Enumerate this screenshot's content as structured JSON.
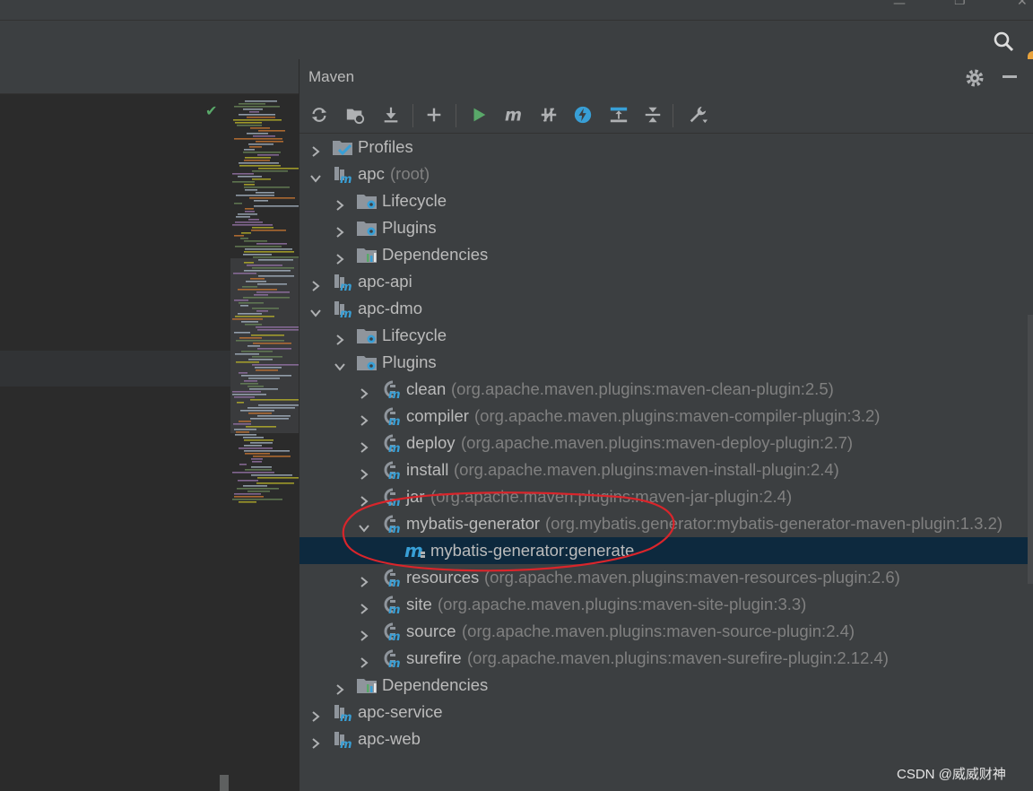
{
  "maven": {
    "title": "Maven",
    "toolbar": [
      {
        "name": "reload-all-maven-projects-button",
        "icon": "refresh-icon"
      },
      {
        "name": "generate-sources-button",
        "icon": "folder-refresh-icon"
      },
      {
        "name": "download-sources-button",
        "icon": "download-icon"
      },
      {
        "name": "add-maven-project-button",
        "icon": "plus-icon"
      },
      {
        "name": "run-maven-build-button",
        "icon": "play-icon"
      },
      {
        "name": "execute-maven-goal-button",
        "icon": "maven-m-icon"
      },
      {
        "name": "toggle-offline-mode-button",
        "icon": "offline-icon"
      },
      {
        "name": "skip-tests-button",
        "icon": "lightning-icon"
      },
      {
        "name": "show-dependencies-button",
        "icon": "dependencies-diagram-icon"
      },
      {
        "name": "collapse-all-button",
        "icon": "collapse-icon"
      },
      {
        "name": "maven-settings-button",
        "icon": "wrench-icon"
      }
    ],
    "tree": [
      {
        "level": 0,
        "expanded": false,
        "icon": "profiles",
        "label": "Profiles",
        "detail": ""
      },
      {
        "level": 0,
        "expanded": true,
        "icon": "project",
        "label": "apc",
        "detail": "(root)"
      },
      {
        "level": 1,
        "expanded": false,
        "icon": "lifecycle",
        "label": "Lifecycle",
        "detail": ""
      },
      {
        "level": 1,
        "expanded": false,
        "icon": "plugins",
        "label": "Plugins",
        "detail": ""
      },
      {
        "level": 1,
        "expanded": false,
        "icon": "dependencies",
        "label": "Dependencies",
        "detail": ""
      },
      {
        "level": 0,
        "expanded": false,
        "icon": "project",
        "label": "apc-api",
        "detail": ""
      },
      {
        "level": 0,
        "expanded": true,
        "icon": "project",
        "label": "apc-dmo",
        "detail": ""
      },
      {
        "level": 1,
        "expanded": false,
        "icon": "lifecycle",
        "label": "Lifecycle",
        "detail": ""
      },
      {
        "level": 1,
        "expanded": true,
        "icon": "plugins",
        "label": "Plugins",
        "detail": ""
      },
      {
        "level": 2,
        "expanded": false,
        "icon": "plugin",
        "label": "clean",
        "detail": "(org.apache.maven.plugins:maven-clean-plugin:2.5)"
      },
      {
        "level": 2,
        "expanded": false,
        "icon": "plugin",
        "label": "compiler",
        "detail": "(org.apache.maven.plugins:maven-compiler-plugin:3.2)"
      },
      {
        "level": 2,
        "expanded": false,
        "icon": "plugin",
        "label": "deploy",
        "detail": "(org.apache.maven.plugins:maven-deploy-plugin:2.7)"
      },
      {
        "level": 2,
        "expanded": false,
        "icon": "plugin",
        "label": "install",
        "detail": "(org.apache.maven.plugins:maven-install-plugin:2.4)"
      },
      {
        "level": 2,
        "expanded": false,
        "icon": "plugin",
        "label": "jar",
        "detail": "(org.apache.maven.plugins:maven-jar-plugin:2.4)"
      },
      {
        "level": 2,
        "expanded": true,
        "icon": "plugin",
        "label": "mybatis-generator",
        "detail": "(org.mybatis.generator:mybatis-generator-maven-plugin:1.3.2)"
      },
      {
        "level": 3,
        "expanded": null,
        "icon": "goal",
        "label": "mybatis-generator:generate",
        "detail": "",
        "selected": true
      },
      {
        "level": 2,
        "expanded": false,
        "icon": "plugin",
        "label": "resources",
        "detail": "(org.apache.maven.plugins:maven-resources-plugin:2.6)"
      },
      {
        "level": 2,
        "expanded": false,
        "icon": "plugin",
        "label": "site",
        "detail": "(org.apache.maven.plugins:maven-site-plugin:3.3)"
      },
      {
        "level": 2,
        "expanded": false,
        "icon": "plugin",
        "label": "source",
        "detail": "(org.apache.maven.plugins:maven-source-plugin:2.4)"
      },
      {
        "level": 2,
        "expanded": false,
        "icon": "plugin",
        "label": "surefire",
        "detail": "(org.apache.maven.plugins:maven-surefire-plugin:2.12.4)"
      },
      {
        "level": 1,
        "expanded": false,
        "icon": "dependencies",
        "label": "Dependencies",
        "detail": ""
      },
      {
        "level": 0,
        "expanded": false,
        "icon": "project",
        "label": "apc-service",
        "detail": ""
      },
      {
        "level": 0,
        "expanded": false,
        "icon": "project",
        "label": "apc-web",
        "detail": ""
      }
    ]
  },
  "watermark": "CSDN @威威财神",
  "colors": {
    "background": "#3c3f41",
    "editor": "#2b2b2b",
    "selection": "#0d293e",
    "maven_blue": "#389fd6",
    "run_green": "#59a869",
    "annotation_red": "#d9252b"
  }
}
